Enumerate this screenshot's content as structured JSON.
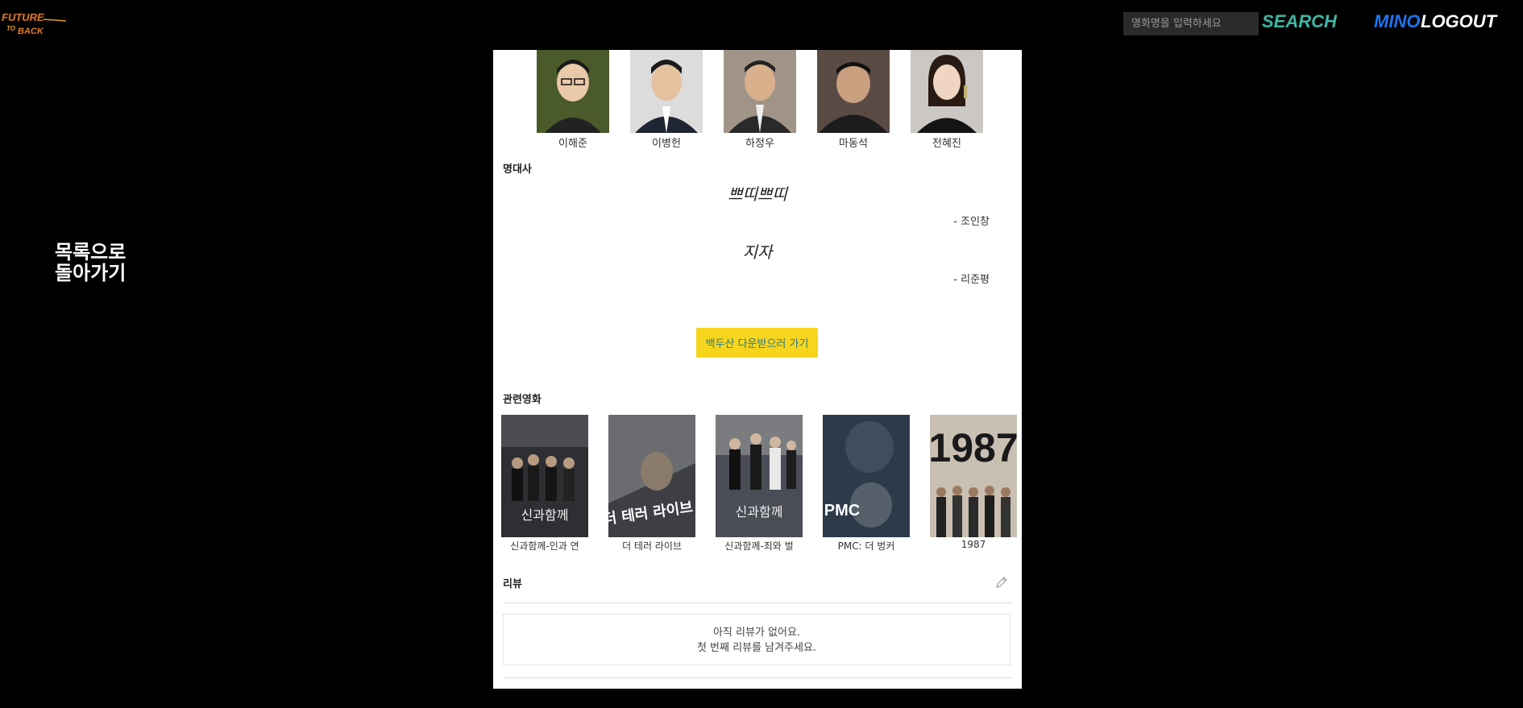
{
  "header": {
    "logo_alt": "FUTURE TO BACK",
    "search": {
      "placeholder": "영화명을 입력하세요",
      "button_label": "SEARCH"
    },
    "user_name": "MINO",
    "logout_label": "LOGOUT"
  },
  "back_link": {
    "line1": "목록으로",
    "line2": "돌아가기"
  },
  "actors": [
    {
      "name": "이해준",
      "photo_color": "#4a5a2a"
    },
    {
      "name": "이병헌",
      "photo_color": "#d8d8d8"
    },
    {
      "name": "하정우",
      "photo_color": "#9a8a7e"
    },
    {
      "name": "마동석",
      "photo_color": "#5a4a44"
    },
    {
      "name": "전혜진",
      "photo_color": "#c9c5c2"
    }
  ],
  "quotes_section": {
    "title": "명대사",
    "quotes": [
      {
        "text": "쁘띠쁘띠",
        "author": "- 조인창"
      },
      {
        "text": "지자",
        "author": "- 리준평"
      }
    ]
  },
  "download_button": "백두산 다운받으러 가기",
  "related_section": {
    "title": "관련영화",
    "movies": [
      {
        "title": "신과함께-인과 연",
        "poster_text": "신과함께",
        "color": "#2d2f33"
      },
      {
        "title": "더 테러 라이브",
        "poster_text": "더 테러 라이브",
        "color": "#3d3f44"
      },
      {
        "title": "신과함께-죄와 벌",
        "poster_text": "신과함께",
        "color": "#4a4d55"
      },
      {
        "title": "PMC: 더 벙커",
        "poster_text": "PMC",
        "color": "#2c3a4a"
      },
      {
        "title": "1987",
        "poster_text": "1987",
        "color": "#5a5450"
      }
    ]
  },
  "review_section": {
    "title": "리뷰",
    "empty_line1": "아직 리뷰가 없어요.",
    "empty_line2": "첫 번째 리뷰를 남겨주세요."
  }
}
